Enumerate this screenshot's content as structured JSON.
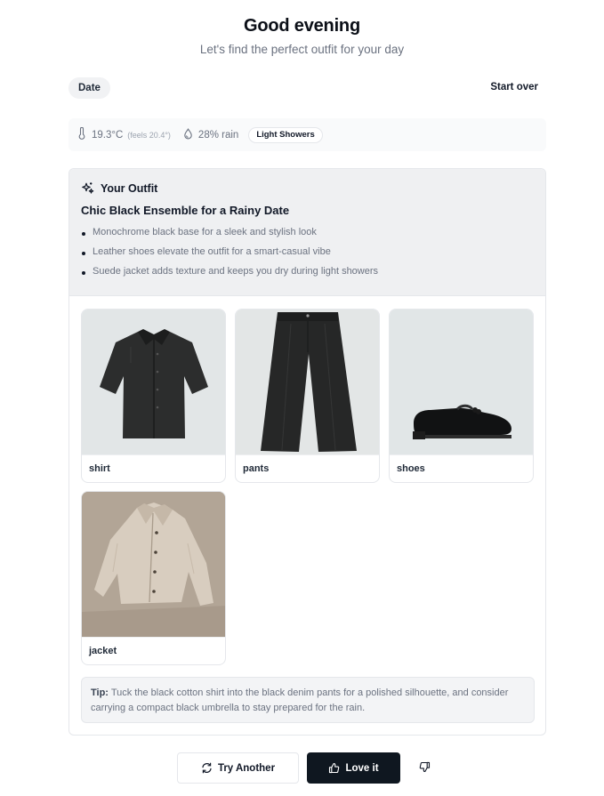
{
  "header": {
    "greeting": "Good evening",
    "subtitle": "Let's find the perfect outfit for your day"
  },
  "controls": {
    "occasion": "Date",
    "start_over": "Start over"
  },
  "weather": {
    "temperature": "19.3°C",
    "feels_like": "(feels 20.4°)",
    "rain": "28% rain",
    "condition": "Light Showers",
    "icons": [
      "thermometer-icon",
      "droplet-icon"
    ]
  },
  "outfit": {
    "section_title": "Your Outfit",
    "name": "Chic Black Ensemble for a Rainy Date",
    "highlights": [
      "Monochrome black base for a sleek and stylish look",
      "Leather shoes elevate the outfit for a smart-casual vibe",
      "Suede jacket adds texture and keeps you dry during light showers"
    ],
    "items": [
      {
        "label": "shirt"
      },
      {
        "label": "pants"
      },
      {
        "label": "shoes"
      },
      {
        "label": "jacket"
      }
    ],
    "tip_label": "Tip:",
    "tip_text": " Tuck the black cotton shirt into the black denim pants for a polished silhouette, and consider carrying a compact black umbrella to stay prepared for the rain."
  },
  "actions": {
    "try_another": "Try Another",
    "love_it": "Love it"
  },
  "colors": {
    "primary_button": "#0f1720",
    "card_header_bg": "#eff0f2",
    "muted_text": "#6b7280"
  }
}
